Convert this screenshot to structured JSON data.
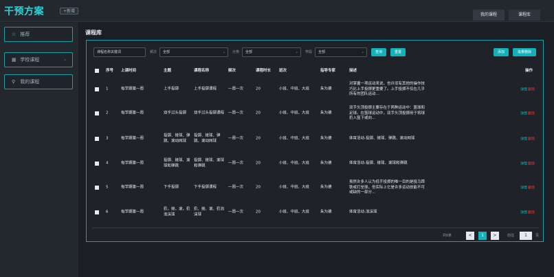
{
  "brand": {
    "title": "干预方案",
    "badge": "+新增"
  },
  "top_nav": {
    "my_course": "我的课程",
    "course_lib": "课程库"
  },
  "sidebar": {
    "items": [
      {
        "icon": "star-icon",
        "label": "推荐"
      },
      {
        "icon": "school-icon",
        "label": "学校课程"
      },
      {
        "icon": "user-icon",
        "label": "我的课程"
      }
    ]
  },
  "page_title": "课程库",
  "filters": {
    "keyword_placeholder": "课程名称关键词",
    "label_freq": "频次",
    "freq_value": "全部",
    "label_category": "分类",
    "category_value": "全部",
    "label_term": "学段",
    "term_value": "全部",
    "search": "查询",
    "reset": "重置",
    "add": "添加",
    "batch_delete": "批量删除"
  },
  "table": {
    "headers": {
      "index": "序号",
      "time": "上课时间",
      "topic": "主题",
      "course": "课程名称",
      "freq": "频次",
      "duration": "课程时长",
      "level": "班次",
      "expert": "指导专家",
      "desc": "描述",
      "ops": "操作"
    },
    "rows": [
      {
        "index": "1",
        "time": "每学期第一周",
        "topic": "上手投掷",
        "course": "上手投掷课程",
        "freq": "一周一次",
        "duration": "20",
        "level": "小班、中班、大班",
        "expert": "朱为德",
        "desc": "对掌握一项运动来说，也许没有其他的操作技巧比上手投掷更重要了。上手投掷不仅在几乎所有的团队运动…"
      },
      {
        "index": "2",
        "time": "每学期第一周",
        "topic": "双手过头投掷",
        "course": "双手过头投掷课程",
        "freq": "一周一次",
        "duration": "20",
        "level": "小班、中班、大班",
        "expert": "朱为德",
        "desc": "双手头顶投掷主要存在于两种运动中：篮球和足球。在篮球运动中，双手头顶投掷用于将球扔入篮下或向…"
      },
      {
        "index": "3",
        "time": "每学期第一周",
        "topic": "投掷、接球、弹跳、滚动网球",
        "course": "投掷、接球、弹跳、滚动网球",
        "freq": "一周一次",
        "duration": "20",
        "level": "小班、中班、大班",
        "expert": "朱为德",
        "desc": "体育活动-投掷、接球、弹跳、滚动网球"
      },
      {
        "index": "4",
        "time": "每学期第一周",
        "topic": "投掷、接球、滚球和弹跳",
        "course": "投掷、接球、滚球和弹跳",
        "freq": "一周一次",
        "duration": "20",
        "level": "小班、中班、大班",
        "expert": "朱为德",
        "desc": "体育活动-投掷、接球、滚球和弹跳"
      },
      {
        "index": "5",
        "time": "每学期第一周",
        "topic": "下手投掷",
        "course": "下手投掷课程",
        "freq": "一周一次",
        "duration": "20",
        "level": "小班、中班、大班",
        "expert": "朱为德",
        "desc": "虽然许多人认为低手投掷的唯一目的是投马蹄铁或打垒球，但实际上它是许多运动技能不可或缺的一部分…"
      },
      {
        "index": "6",
        "time": "每学期第一周",
        "topic": "扔，接，滚，扔泡沫球",
        "course": "扔、接、滚、扔泡沫球",
        "freq": "一周一次",
        "duration": "20",
        "level": "小班、中班、大班",
        "expert": "朱为德",
        "desc": "体育活动-泡沫球"
      }
    ],
    "op_detail": "详情",
    "op_delete": "删除"
  },
  "pager": {
    "total": "共6条",
    "prev": "<",
    "page": "1",
    "next": ">",
    "goto": "前往",
    "goto_value": "1",
    "unit": "页"
  },
  "colors": {
    "accent": "#14b1b8",
    "danger": "#e33b3b",
    "bg": "#1b1e24"
  }
}
